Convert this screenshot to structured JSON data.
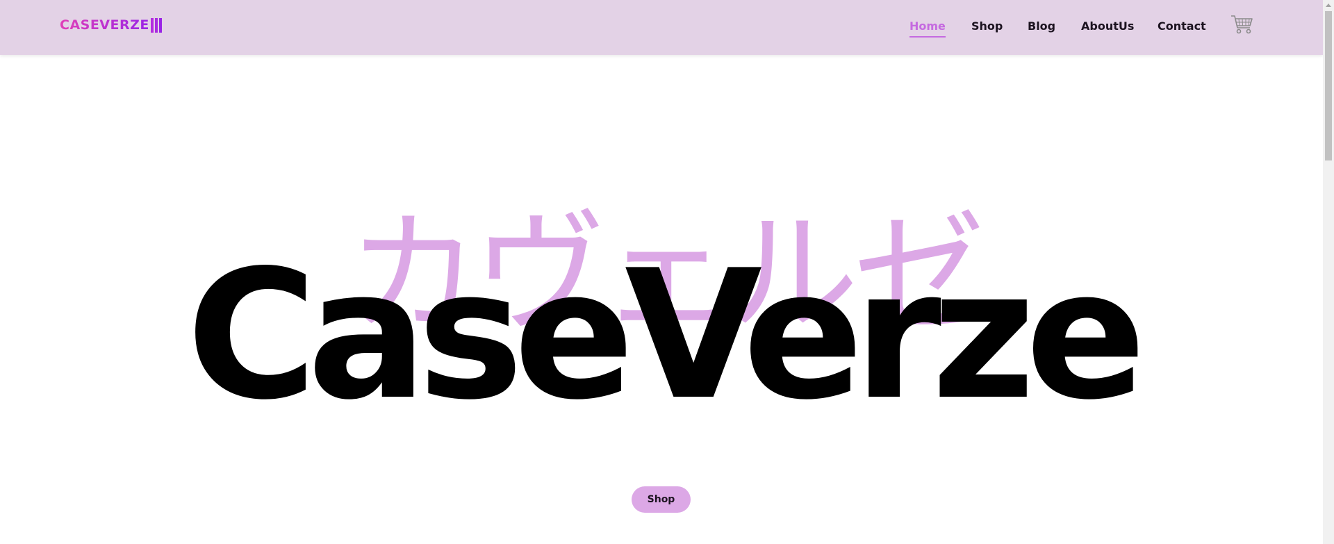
{
  "header": {
    "logo_text": "CASEVERZE",
    "nav": {
      "home": "Home",
      "shop": "Shop",
      "blog": "Blog",
      "about": "AboutUs",
      "contact": "Contact"
    },
    "cart_icon": "shopping-cart-icon"
  },
  "hero": {
    "japanese_text": "カヴェルゼ",
    "title": "CaseVerze",
    "shop_button": "Shop"
  },
  "colors": {
    "header_bg": "#e3d2e6",
    "accent": "#c56ae0",
    "hero_jp": "#dca8e6",
    "button_bg": "#dca8e6",
    "logo_gradient_start": "#e040b8",
    "logo_gradient_end": "#9a24e6"
  }
}
